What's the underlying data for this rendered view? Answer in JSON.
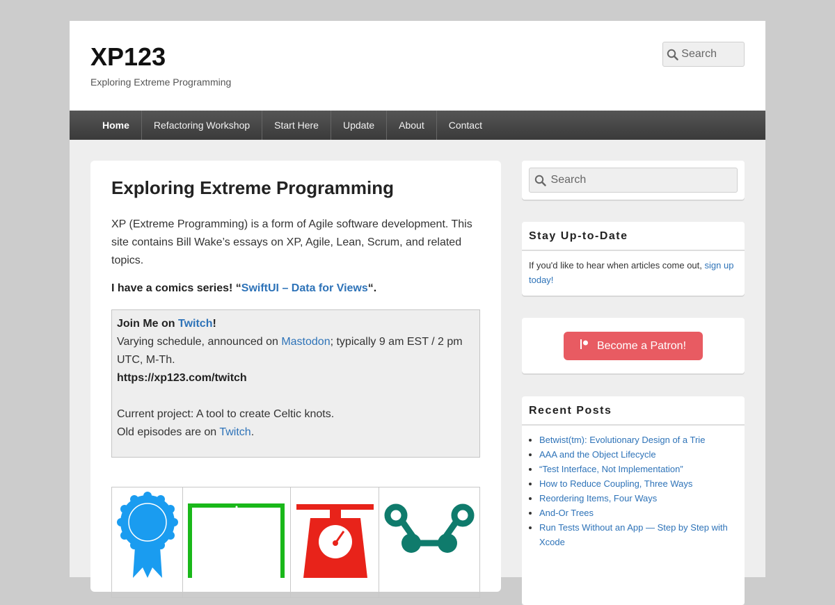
{
  "site": {
    "title": "XP123",
    "description": "Exploring Extreme Programming"
  },
  "header_search": {
    "placeholder": "Search"
  },
  "nav": {
    "items": [
      {
        "label": "Home",
        "active": true
      },
      {
        "label": "Refactoring Workshop",
        "active": false
      },
      {
        "label": "Start Here",
        "active": false
      },
      {
        "label": "Update",
        "active": false
      },
      {
        "label": "About",
        "active": false
      },
      {
        "label": "Contact",
        "active": false
      }
    ]
  },
  "main": {
    "title": "Exploring Extreme Programming",
    "intro": "XP (Extreme Programming) is a form of Agile software development. This site contains Bill Wake’s essays on XP, Agile, Lean, Scrum, and related topics.",
    "comics_prefix": "I have a comics series! “",
    "comics_link": "SwiftUI – Data for Views",
    "comics_suffix": "“.",
    "twitch": {
      "join_prefix": "Join Me on ",
      "join_link": "Twitch",
      "join_suffix": "!",
      "schedule_prefix": "Varying schedule, announced on ",
      "schedule_link": "Mastodon",
      "schedule_suffix": "; typically 9 am EST / 2 pm UTC, M-Th.",
      "url": "https://xp123.com/twitch",
      "project": "Current project: A tool to create Celtic knots.",
      "old_prefix": "Old episodes are on ",
      "old_link": "Twitch",
      "old_suffix": "."
    },
    "icons": [
      {
        "name": "award-ribbon-icon",
        "color": "#1a9cf0"
      },
      {
        "name": "whiteboard-icon",
        "color": "#1ab81a"
      },
      {
        "name": "scale-icon",
        "color": "#e8231a"
      },
      {
        "name": "network-nodes-icon",
        "color": "#0f7b6c"
      }
    ]
  },
  "sidebar": {
    "search_placeholder": "Search",
    "stay_title": "Stay Up-to-Date",
    "stay_text": "If you'd like to hear when articles come out, ",
    "stay_link": "sign up today!",
    "patron_label": "Become a Patron!",
    "recent_title": "Recent Posts",
    "recent_posts": [
      "Betwist(tm): Evolutionary Design of a Trie",
      "AAA and the Object Lifecycle",
      "“Test Interface, Not Implementation”",
      "How to Reduce Coupling, Three Ways",
      "Reordering Items, Four Ways",
      "And-Or Trees",
      "Run Tests Without an App — Step by Step with Xcode"
    ]
  },
  "colors": {
    "link": "#2e73b8",
    "patron": "#e85b62",
    "nav_bg": "#444444",
    "page_bg": "#cccccc"
  }
}
